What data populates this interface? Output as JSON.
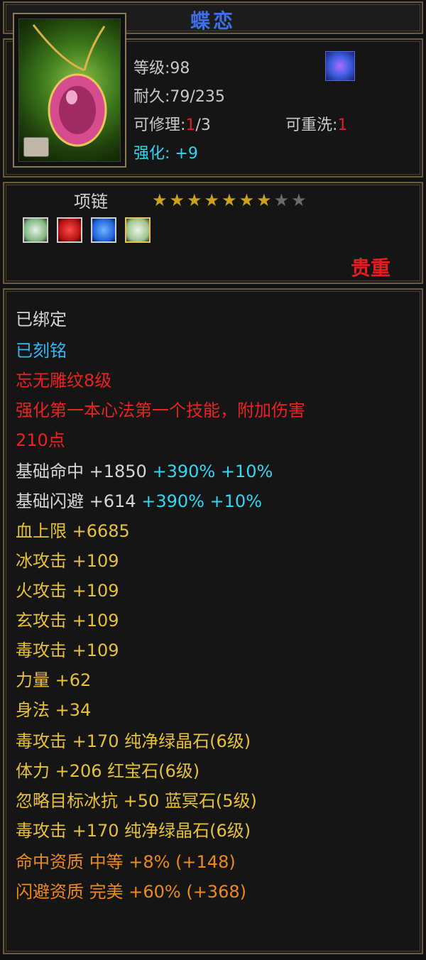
{
  "title": "蝶恋",
  "stats": {
    "level": "等级:98",
    "durability": "耐久:79/235",
    "repair_label": "可修理:",
    "repair_value": "1",
    "repair_max": "/3",
    "rewash_label": "可重洗:",
    "rewash_value": "1",
    "enhance": "强化: +9"
  },
  "item_type": "项链",
  "stars": {
    "filled": 7,
    "total": 9
  },
  "gem_slots": [
    "white-gem-icon",
    "red-gem-icon",
    "blue-gem-icon",
    "white-gem-icon"
  ],
  "rarity": "贵重",
  "lines": [
    {
      "text": "已绑定",
      "color": "#d6d6d6"
    },
    {
      "text": "已刻铭",
      "color": "#33b8f2"
    },
    {
      "text": "忘无雕纹8级",
      "color": "#ea2222"
    },
    {
      "text": "强化第一本心法第一个技能，附加伤害",
      "color": "#ea2222"
    },
    {
      "text": "210点",
      "color": "#ea2222"
    }
  ],
  "attributes": [
    {
      "label": "基础命中",
      "value": "+1850",
      "extra": "+390% +10%"
    },
    {
      "label": "基础闪避",
      "value": "+614",
      "extra": "+390% +10%"
    },
    {
      "label": "血上限",
      "value": "+6685",
      "extra": ""
    },
    {
      "label": "冰攻击",
      "value": "+109",
      "extra": ""
    },
    {
      "label": "火攻击",
      "value": "+109",
      "extra": ""
    },
    {
      "label": "玄攻击",
      "value": "+109",
      "extra": ""
    },
    {
      "label": "毒攻击",
      "value": "+109",
      "extra": ""
    },
    {
      "label": "力量",
      "value": "+62",
      "extra": ""
    },
    {
      "label": "身法",
      "value": "+34",
      "extra": ""
    }
  ],
  "gem_lines": [
    "毒攻击 +170 纯净绿晶石(6级)",
    "体力 +206 红宝石(6级)",
    "忽略目标冰抗 +50 蓝冥石(5级)",
    "毒攻击 +170 纯净绿晶石(6级)"
  ],
  "aptitudes": [
    {
      "text": "命中资质 中等 +8% (+148)"
    },
    {
      "text": "闪避资质 完美 +60% (+368)"
    }
  ]
}
